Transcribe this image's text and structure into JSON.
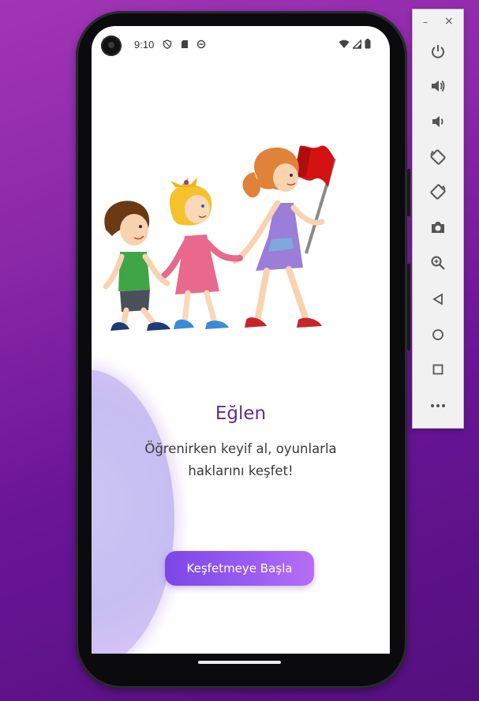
{
  "status_bar": {
    "time": "9:10",
    "left_icons": [
      "shield-icon",
      "sd-card-icon",
      "sync-icon"
    ],
    "right_icons": [
      "wifi-icon",
      "cellular-signal-icon",
      "battery-icon"
    ]
  },
  "onboarding": {
    "title": "Eğlen",
    "subtitle": "Öğrenirken keyif al, oyunlarla haklarını keşfet!",
    "cta_label": "Keşfetmeye Başla",
    "illustration": "children-walking-with-flag-illustration"
  },
  "colors": {
    "title": "#5a2d96",
    "button_gradient_start": "#7c46e8",
    "button_gradient_end": "#b66ff5",
    "background_blob": "#c6bdf1",
    "page_background": "#8a28a8"
  },
  "emulator_toolbar": {
    "window_controls": {
      "minimize": "–",
      "close": "×"
    },
    "buttons": [
      "power-icon",
      "volume-up-icon",
      "volume-down-icon",
      "rotate-left-icon",
      "rotate-right-icon",
      "camera-icon",
      "zoom-icon",
      "back-icon",
      "home-icon",
      "overview-icon",
      "more-icon"
    ]
  }
}
